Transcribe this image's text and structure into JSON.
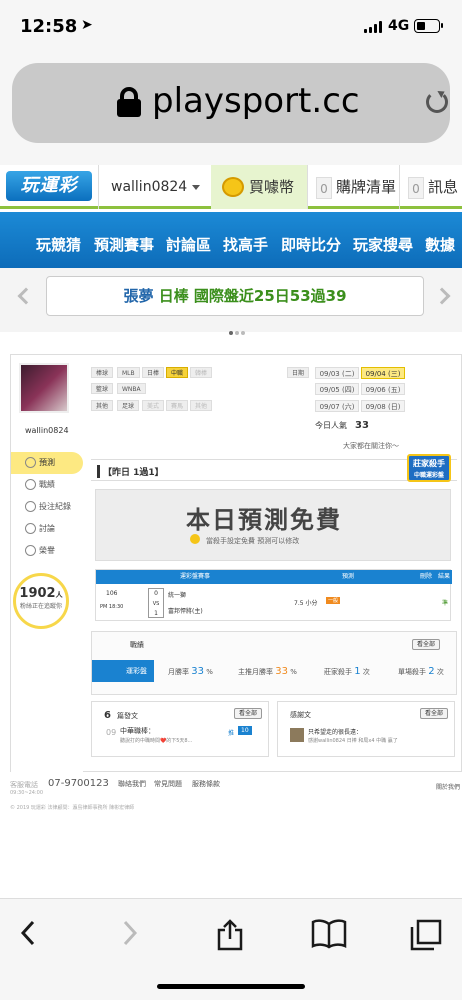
{
  "status": {
    "time": "12:58",
    "network": "4G"
  },
  "browser": {
    "url": "playsport.cc"
  },
  "header": {
    "logo": "玩運彩",
    "username": "wallin0824",
    "buy_coin": "買噱幣",
    "cart_count": "0",
    "cart_label": "購牌清單",
    "msg_count": "0",
    "msg_label": "訊息"
  },
  "nav": [
    "玩競猜",
    "預測賽事",
    "討論區",
    "找高手",
    "即時比分",
    "玩家搜尋",
    "數據"
  ],
  "banner": {
    "name": "張夢",
    "text": "日棒 國際盤近25日53過39"
  },
  "profile": {
    "username": "wallin0824",
    "menu": [
      "預測",
      "戰績",
      "投注紀錄",
      "討論",
      "榮譽"
    ],
    "followers": "1902",
    "followers_unit": "人",
    "followers_text": "粉絲正在追蹤你"
  },
  "filters": {
    "row1_label": "棒球",
    "row1": [
      "MLB",
      "日棒",
      "中職",
      "韓棒"
    ],
    "row2_label": "籃球",
    "row2": [
      "WNBA"
    ],
    "row3_label": "其他",
    "row3": [
      "足球",
      "美式",
      "賽馬",
      "其他"
    ],
    "date_label": "日期",
    "dates": [
      "09/03 (二)",
      "09/04 (三)",
      "09/05 (四)",
      "09/06 (五)",
      "09/07 (六)",
      "09/08 (日)"
    ],
    "visit_label": "今日人氣",
    "visit_count": "33",
    "notice": "大家都在關注你～"
  },
  "result": {
    "text": "【昨日 1過1】",
    "badge_line1": "莊家殺手",
    "badge_line2": "中職運彩盤"
  },
  "free": {
    "title": "本日預測免費",
    "subtitle": "當殺手設定免費 預測可以修改"
  },
  "prediction": {
    "headers": [
      "運彩盤賽事",
      "預測",
      "刪除",
      "結果"
    ],
    "game_no": "106",
    "time": "PM 18:30",
    "score_top": "0",
    "vs": "VS",
    "score_bottom": "1",
    "team1": "統一獅",
    "team2": "富邦悍將(主)",
    "pick": "7.5 小分",
    "pick_tag": "一般",
    "result": "準"
  },
  "stats": {
    "title": "戰績",
    "see_all": "看全部",
    "tab": "運彩盤",
    "month_label": "月勝率",
    "month_value": "33",
    "prev_label": "主推月勝率",
    "prev_value": "33",
    "killer_label": "莊家殺手",
    "killer_value": "1",
    "killer_unit": "次",
    "single_label": "單場殺手",
    "single_value": "2",
    "single_unit": "次",
    "percent": "%"
  },
  "posts": {
    "count": "6",
    "title": "篇發文",
    "see_all": "看全部",
    "date": "09",
    "day": "03",
    "item_title": "中華職棒：",
    "item_snippet": "聽說打的中職時間❤️的下5天8...",
    "replies_label": "推",
    "replies": "10"
  },
  "replies": {
    "title": "感謝文",
    "see_all": "看全部",
    "item_title": "只希望走的很長遠：",
    "item_snippet": "感謝wallin0824 日棒 和局x4 中職 贏了"
  },
  "footer": {
    "service_label": "客服電話",
    "phone": "07-9700123",
    "hours": "09:30~24:00",
    "links": [
      "聯絡我們",
      "常見問題",
      "服務條款"
    ],
    "right_link": "關於我們",
    "copyright": "© 2019 玩運彩 法律顧問：瀛島律師事務所 陳彬宏律師"
  }
}
